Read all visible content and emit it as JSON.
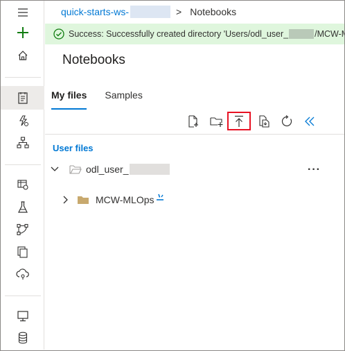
{
  "breadcrumb": {
    "workspace": "quick-starts-ws-",
    "separator": ">",
    "current": "Notebooks"
  },
  "banner": {
    "text_before": "Success: Successfully created directory 'Users/odl_user_",
    "text_after": "/MCW-MLOp",
    "color": "#dff6dd"
  },
  "page": {
    "title": "Notebooks"
  },
  "tabs": [
    {
      "label": "My files",
      "active": true
    },
    {
      "label": "Samples",
      "active": false
    }
  ],
  "toolbar": {
    "icons": [
      "new-file-icon",
      "new-folder-icon",
      "upload-icon",
      "copy-path-icon",
      "refresh-icon",
      "collapse-icon"
    ],
    "highlighted": "upload-icon",
    "highlight_color": "#e81123"
  },
  "files": {
    "section_label": "User files",
    "root": {
      "name": "odl_user_",
      "expanded": true,
      "more": "···"
    },
    "children": [
      {
        "name": "MCW-MLOps",
        "expanded": false
      }
    ]
  },
  "rail": {
    "icons": [
      "menu-icon",
      "plus-icon",
      "home-icon",
      "notebooks-icon",
      "automl-icon",
      "designer-icon",
      "datasets-icon",
      "experiments-icon",
      "pipelines-icon",
      "models-icon",
      "endpoints-icon",
      "compute-icon",
      "datastores-icon"
    ],
    "selected": "notebooks-icon"
  },
  "colors": {
    "accent": "#0078d4",
    "success": "#107c10",
    "plus": "#107c10"
  }
}
